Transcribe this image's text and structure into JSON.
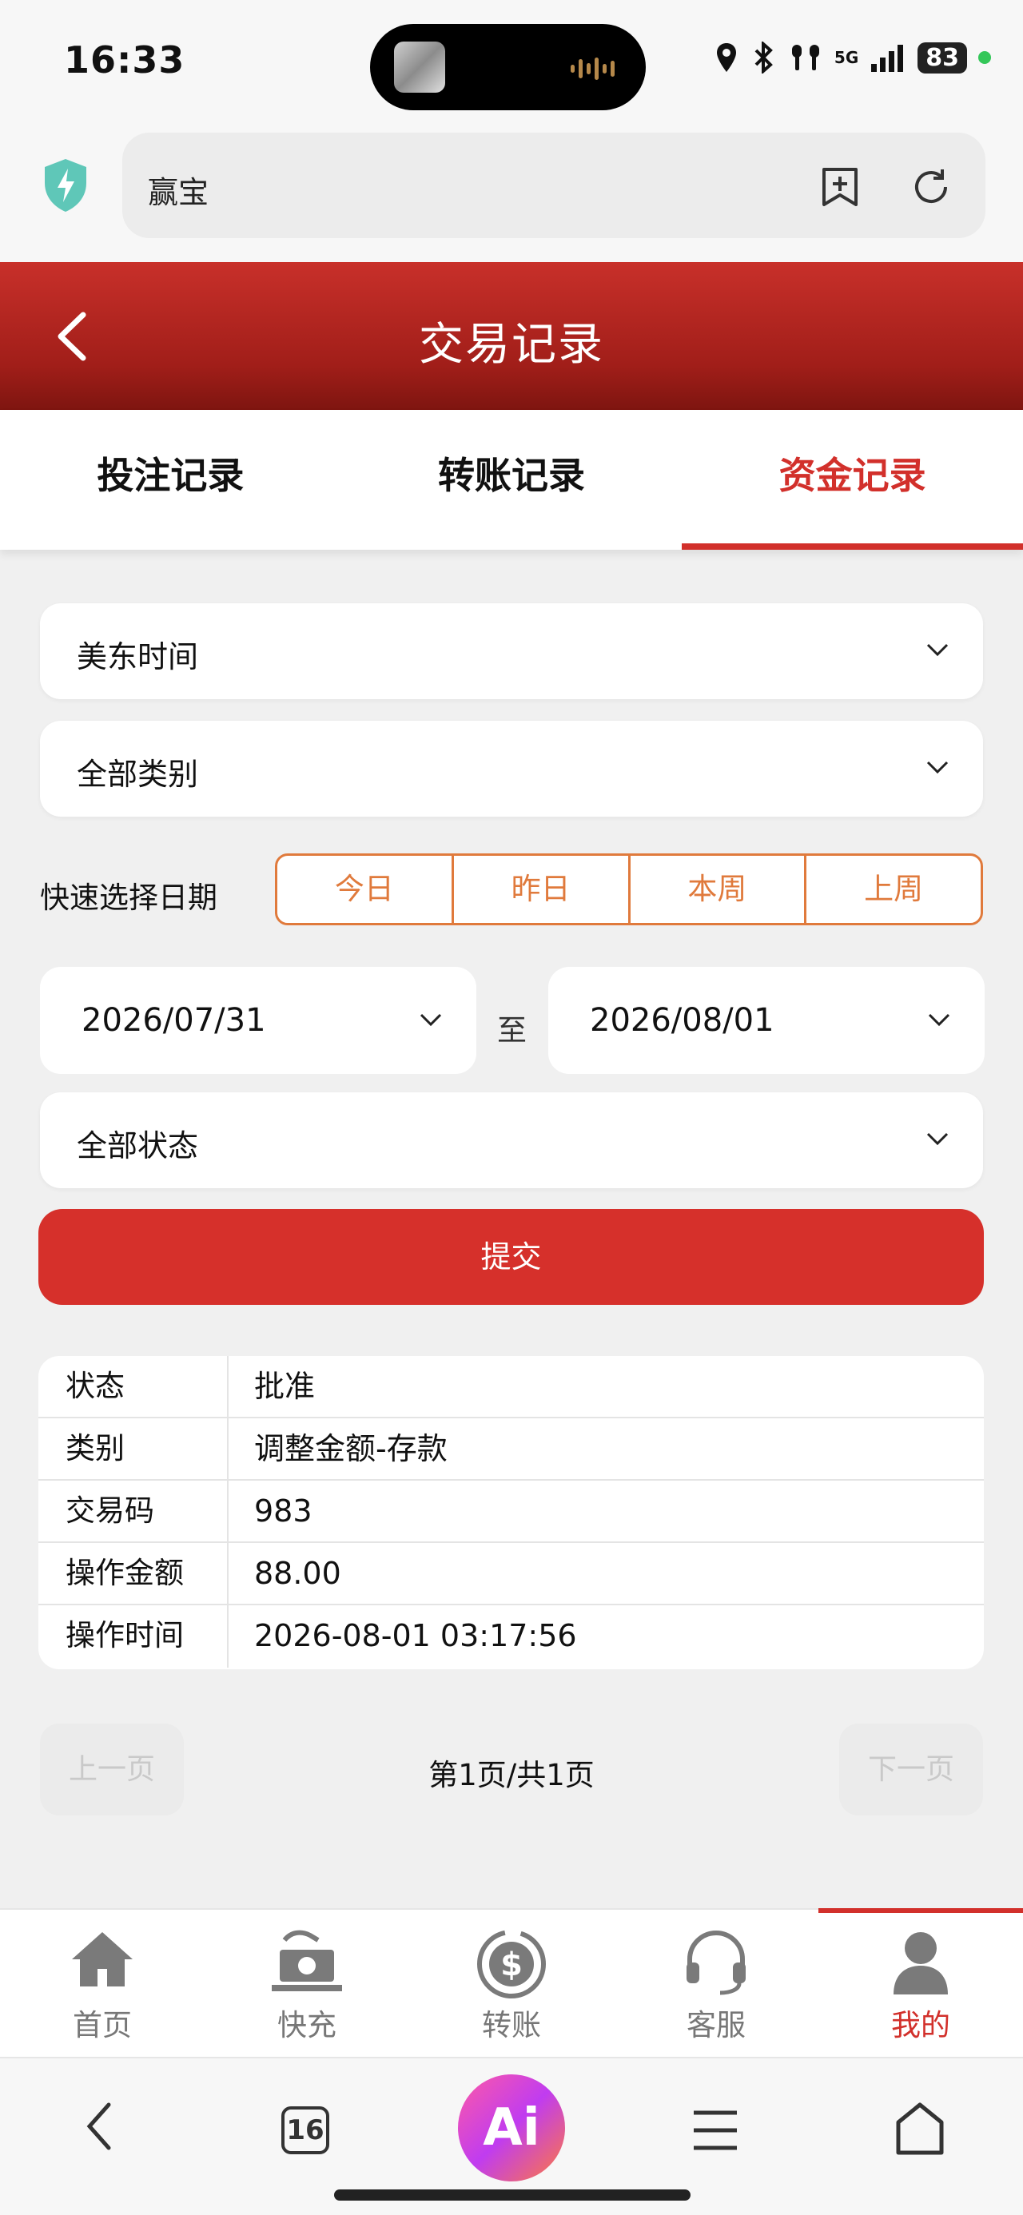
{
  "status_bar": {
    "time": "16:33",
    "network": "5G",
    "battery": "83"
  },
  "browser": {
    "url_text": "赢宝"
  },
  "header": {
    "title": "交易记录"
  },
  "tabs": [
    {
      "label": "投注记录"
    },
    {
      "label": "转账记录"
    },
    {
      "label": "资金记录"
    }
  ],
  "filters": {
    "timezone": "美东时间",
    "category": "全部类别",
    "quick_date_label": "快速选择日期",
    "quick_dates": [
      "今日",
      "昨日",
      "本周",
      "上周"
    ],
    "start_date": "2026/07/31",
    "to_label": "至",
    "end_date": "2026/08/01",
    "status": "全部状态",
    "submit_label": "提交"
  },
  "record": {
    "rows": [
      {
        "key": "状态",
        "value": "批准"
      },
      {
        "key": "类别",
        "value": "调整金额-存款"
      },
      {
        "key": "交易码",
        "value": "983"
      },
      {
        "key": "操作金额",
        "value": "88.00"
      },
      {
        "key": "操作时间",
        "value": "2026-08-01 03:17:56"
      }
    ]
  },
  "pagination": {
    "prev_label": "上一页",
    "info": "第1页/共1页",
    "next_label": "下一页"
  },
  "bottom_nav": [
    {
      "label": "首页",
      "icon": "home-icon"
    },
    {
      "label": "快充",
      "icon": "cash-deposit-icon"
    },
    {
      "label": "转账",
      "icon": "transfer-dollar-icon"
    },
    {
      "label": "客服",
      "icon": "headset-icon"
    },
    {
      "label": "我的",
      "icon": "user-icon"
    }
  ],
  "browser_toolbar": {
    "tab_count": "16",
    "ai_label": "Ai"
  },
  "colors": {
    "brand_red": "#d2302b",
    "accent_orange": "#e07a3c"
  }
}
